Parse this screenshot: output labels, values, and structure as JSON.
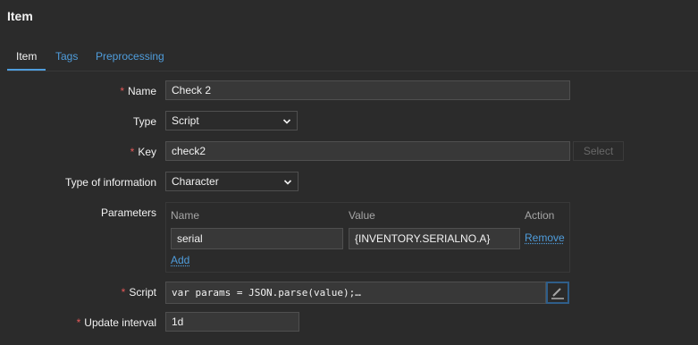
{
  "header": {
    "title": "Item"
  },
  "tabs": [
    {
      "label": "Item"
    },
    {
      "label": "Tags"
    },
    {
      "label": "Preprocessing"
    }
  ],
  "form": {
    "name": {
      "label": "Name",
      "value": "Check 2"
    },
    "type": {
      "label": "Type",
      "value": "Script"
    },
    "key": {
      "label": "Key",
      "value": "check2",
      "select_button": "Select"
    },
    "type_of_information": {
      "label": "Type of information",
      "value": "Character"
    },
    "parameters": {
      "label": "Parameters",
      "columns": [
        "Name",
        "Value",
        "Action"
      ],
      "rows": [
        {
          "name": "serial",
          "value": "{INVENTORY.SERIALNO.A}",
          "action": "Remove"
        }
      ],
      "add_link": "Add"
    },
    "script": {
      "label": "Script",
      "value": "var params = JSON.parse(value);…"
    },
    "update_interval": {
      "label": "Update interval",
      "value": "1d"
    }
  },
  "icons": {
    "select_chevron": "chevron-down-icon",
    "edit": "pencil-icon"
  },
  "colors": {
    "accent": "#4f9ddc",
    "required": "#e45959",
    "background": "#2b2b2b"
  }
}
